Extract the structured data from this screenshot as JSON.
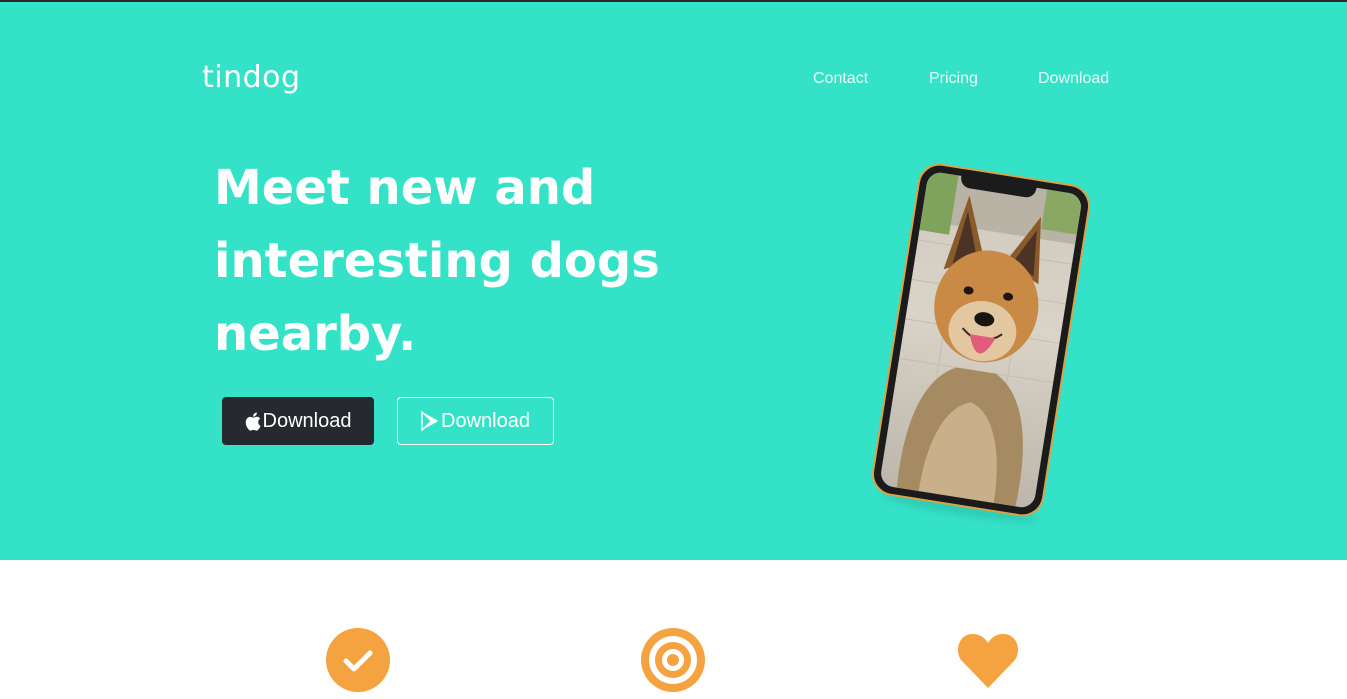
{
  "brand": {
    "name": "tindog"
  },
  "nav": {
    "contact": "Contact",
    "pricing": "Pricing",
    "download": "Download"
  },
  "hero": {
    "headline_line1": "Meet new and",
    "headline_line2": "interesting dogs",
    "headline_line3": "nearby.",
    "apple_button_label": "Download",
    "google_button_label": "Download",
    "phone_image": "iphone-with-dog-photo"
  },
  "features": {
    "icons": [
      "check-circle-icon",
      "bullseye-icon",
      "heart-icon"
    ]
  },
  "colors": {
    "hero_bg": "#34e2c8",
    "accent_orange": "#f4a340",
    "dark_button": "#262a2e",
    "text_white": "#ffffff"
  }
}
